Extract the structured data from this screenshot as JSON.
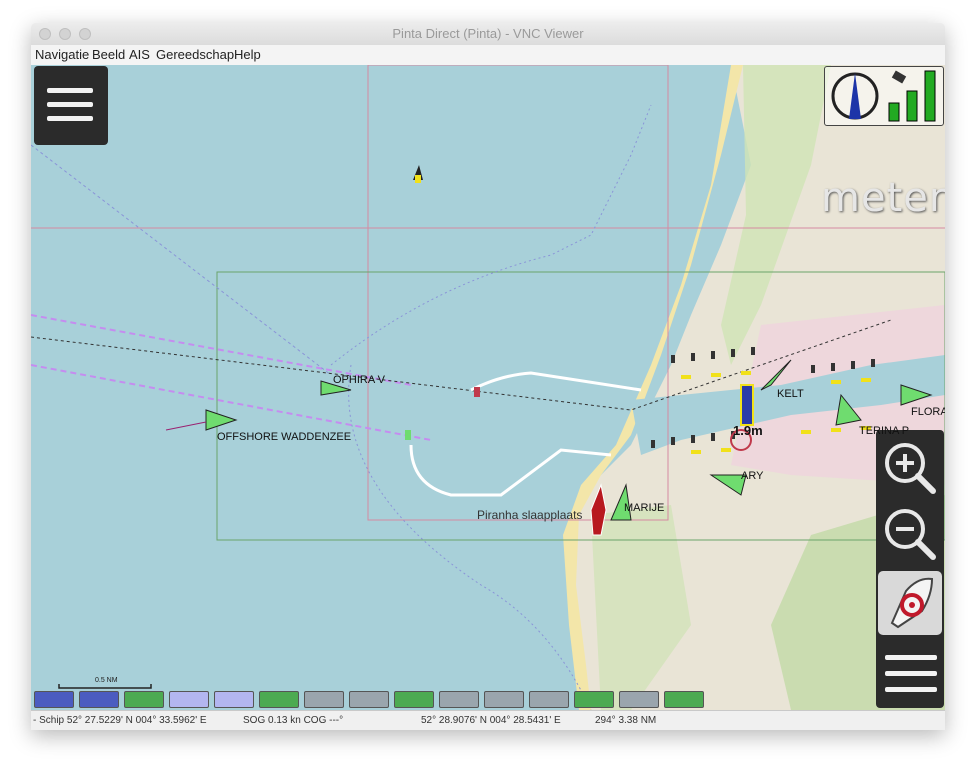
{
  "window": {
    "title": "Pinta Direct (Pinta) - VNC Viewer"
  },
  "menu": {
    "items": [
      "Navigatie",
      "Beeld",
      "AIS",
      "Gereedschap",
      "Help"
    ]
  },
  "map": {
    "vessels": [
      {
        "name": "OPHIRA V"
      },
      {
        "name": "OFFSHORE WADDENZEE"
      },
      {
        "name": "KELT"
      },
      {
        "name": "MARIJE"
      },
      {
        "name": "ARY"
      },
      {
        "name": "FLORA"
      },
      {
        "name": "TERINA P"
      }
    ],
    "poi_label": "Piranha slaapplaats",
    "depth_label": "1.9m",
    "overlay_unit": "meter",
    "scale_label": "0.5 NM"
  },
  "swatches": [
    "#4b5cc0",
    "#4b5cc0",
    "#4caa52",
    "#b3b6f0",
    "#b3b6f0",
    "#4caa52",
    "#9aa5ad",
    "#9aa5ad",
    "#4caa52",
    "#9aa5ad",
    "#9aa5ad",
    "#9aa5ad",
    "#4caa52",
    "#9aa5ad",
    "#4caa52"
  ],
  "status": {
    "ship_position": "- Schip 52° 27.5229' N   004° 33.5962' E",
    "sog_cog": "SOG 0.13 kn  COG ---°",
    "cursor_position": "52° 28.9076' N   004° 28.5431' E",
    "bearing_distance": "294°  3.38 NM"
  },
  "colors": {
    "sea": "#a8d0d9",
    "land": "#e9e4d6",
    "ais_target": "#6fdc6f",
    "control_bg": "#2b2b2b"
  },
  "icons": {
    "menu": "hamburger-icon",
    "compass": "compass-icon",
    "gps": "satellite-signal-icon",
    "zoom_in": "zoom-in-icon",
    "zoom_out": "zoom-out-icon",
    "follow_boat": "boat-follow-icon",
    "settings_menu": "hamburger-icon"
  }
}
